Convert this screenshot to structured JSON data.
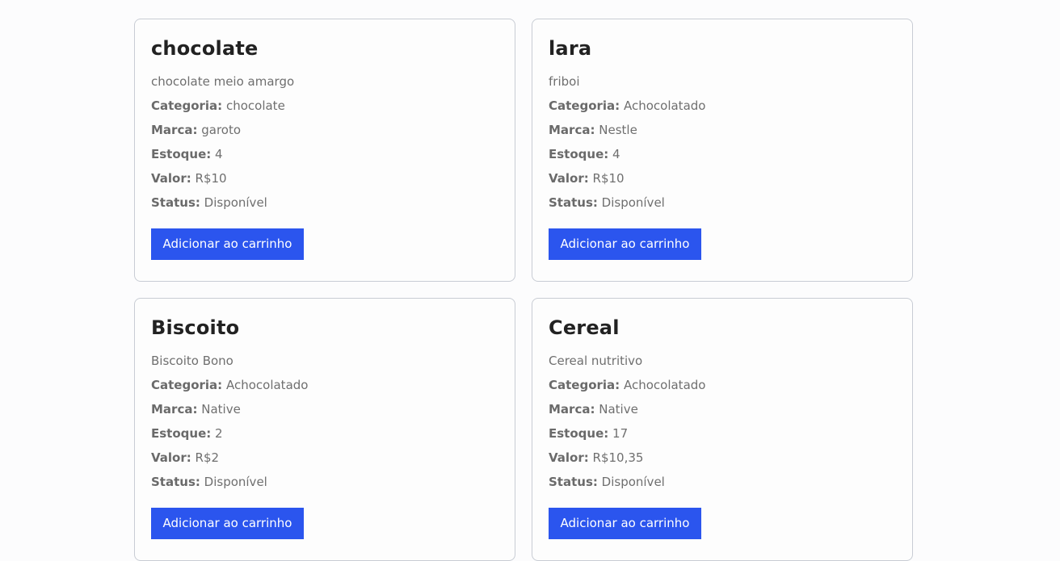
{
  "labels": {
    "categoria": "Categoria:",
    "marca": "Marca:",
    "estoque": "Estoque:",
    "valor": "Valor:",
    "status": "Status:"
  },
  "products": [
    {
      "name": "chocolate",
      "description": "chocolate meio amargo",
      "categoria": "chocolate",
      "marca": "garoto",
      "estoque": "4",
      "valor": "R$10",
      "status": "Disponível",
      "button_label": "Adicionar ao carrinho"
    },
    {
      "name": "lara",
      "description": "friboi",
      "categoria": "Achocolatado",
      "marca": "Nestle",
      "estoque": "4",
      "valor": "R$10",
      "status": "Disponível",
      "button_label": "Adicionar ao carrinho"
    },
    {
      "name": "Biscoito",
      "description": "Biscoito Bono",
      "categoria": "Achocolatado",
      "marca": "Native",
      "estoque": "2",
      "valor": "R$2",
      "status": "Disponível",
      "button_label": "Adicionar ao carrinho"
    },
    {
      "name": "Cereal",
      "description": "Cereal nutritivo",
      "categoria": "Achocolatado",
      "marca": "Native",
      "estoque": "17",
      "valor": "R$10,35",
      "status": "Disponível",
      "button_label": "Adicionar ao carrinho"
    }
  ],
  "colors": {
    "button_bg": "#2b55ee",
    "card_border": "#c8ccd4",
    "title_text": "#222222",
    "body_text": "#6f6f6f"
  }
}
